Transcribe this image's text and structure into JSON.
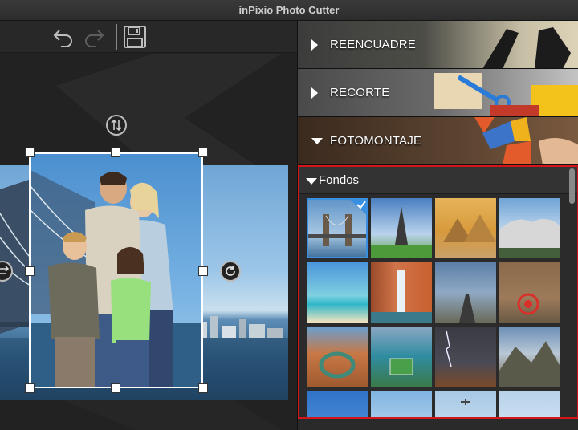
{
  "app": {
    "title": "inPixio Photo Cutter"
  },
  "toolbar": {
    "undo_icon": "undo-arrow-icon",
    "redo_icon": "redo-arrow-icon",
    "save_icon": "floppy-disk-icon"
  },
  "canvas": {
    "flip_icon": "flip-vertical-icon",
    "rotate_icon": "rotate-icon",
    "swap_icon": "swap-horizontal-icon"
  },
  "panel": {
    "sections": [
      {
        "label": "REENCUADRE",
        "expanded": false
      },
      {
        "label": "RECORTE",
        "expanded": false
      },
      {
        "label": "FOTOMONTAJE",
        "expanded": true
      }
    ],
    "fondos": {
      "label": "Fondos",
      "thumbnails": [
        {
          "name": "bridge",
          "selected": true
        },
        {
          "name": "eiffel-tower",
          "selected": false
        },
        {
          "name": "pyramids",
          "selected": false
        },
        {
          "name": "mount-rushmore",
          "selected": false
        },
        {
          "name": "tropical-beach",
          "selected": false
        },
        {
          "name": "waterfall",
          "selected": false
        },
        {
          "name": "desert-road",
          "selected": false
        },
        {
          "name": "bicycle-wall",
          "selected": false
        },
        {
          "name": "canyon-bend",
          "selected": false
        },
        {
          "name": "island-stadium",
          "selected": false
        },
        {
          "name": "storm-lightning",
          "selected": false
        },
        {
          "name": "mountain-valley",
          "selected": false
        },
        {
          "name": "blue-sky-1",
          "selected": false
        },
        {
          "name": "blue-sky-2",
          "selected": false
        },
        {
          "name": "sky-with-plane",
          "selected": false
        },
        {
          "name": "pale-sky",
          "selected": false
        }
      ]
    }
  },
  "colors": {
    "accent": "#3b8fe0",
    "highlight_border": "#d4151a"
  }
}
